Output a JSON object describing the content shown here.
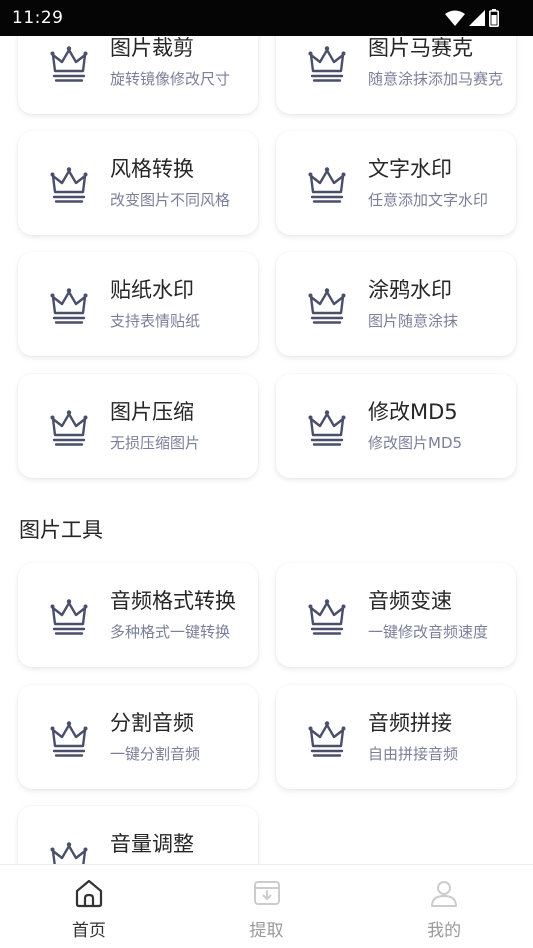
{
  "status_bar": {
    "time": "11:29"
  },
  "cards": [
    {
      "title": "图片裁剪",
      "subtitle": "旋转镜像修改尺寸"
    },
    {
      "title": "图片马赛克",
      "subtitle": "随意涂抹添加马赛克"
    },
    {
      "title": "风格转换",
      "subtitle": "改变图片不同风格"
    },
    {
      "title": "文字水印",
      "subtitle": "任意添加文字水印"
    },
    {
      "title": "贴纸水印",
      "subtitle": "支持表情贴纸"
    },
    {
      "title": "涂鸦水印",
      "subtitle": "图片随意涂抹"
    },
    {
      "title": "图片压缩",
      "subtitle": "无损压缩图片"
    },
    {
      "title": "修改MD5",
      "subtitle": "修改图片MD5"
    }
  ],
  "section": {
    "title": "图片工具"
  },
  "tool_cards": [
    {
      "title": "音频格式转换",
      "subtitle": "多种格式一键转换"
    },
    {
      "title": "音频变速",
      "subtitle": "一键修改音频速度"
    },
    {
      "title": "分割音频",
      "subtitle": "一键分割音频"
    },
    {
      "title": "音频拼接",
      "subtitle": "自由拼接音频"
    },
    {
      "title": "音量调整",
      "subtitle": ""
    }
  ],
  "tabbar": {
    "items": [
      {
        "label": "首页",
        "icon": "home-icon",
        "active": true
      },
      {
        "label": "提取",
        "icon": "download-box-icon",
        "active": false
      },
      {
        "label": "我的",
        "icon": "user-icon",
        "active": false
      }
    ]
  },
  "colors": {
    "icon_stroke": "#4a4f6a",
    "subtitle": "#7a7f9a",
    "active_tab": "#333333",
    "inactive_tab": "#cccccc"
  }
}
